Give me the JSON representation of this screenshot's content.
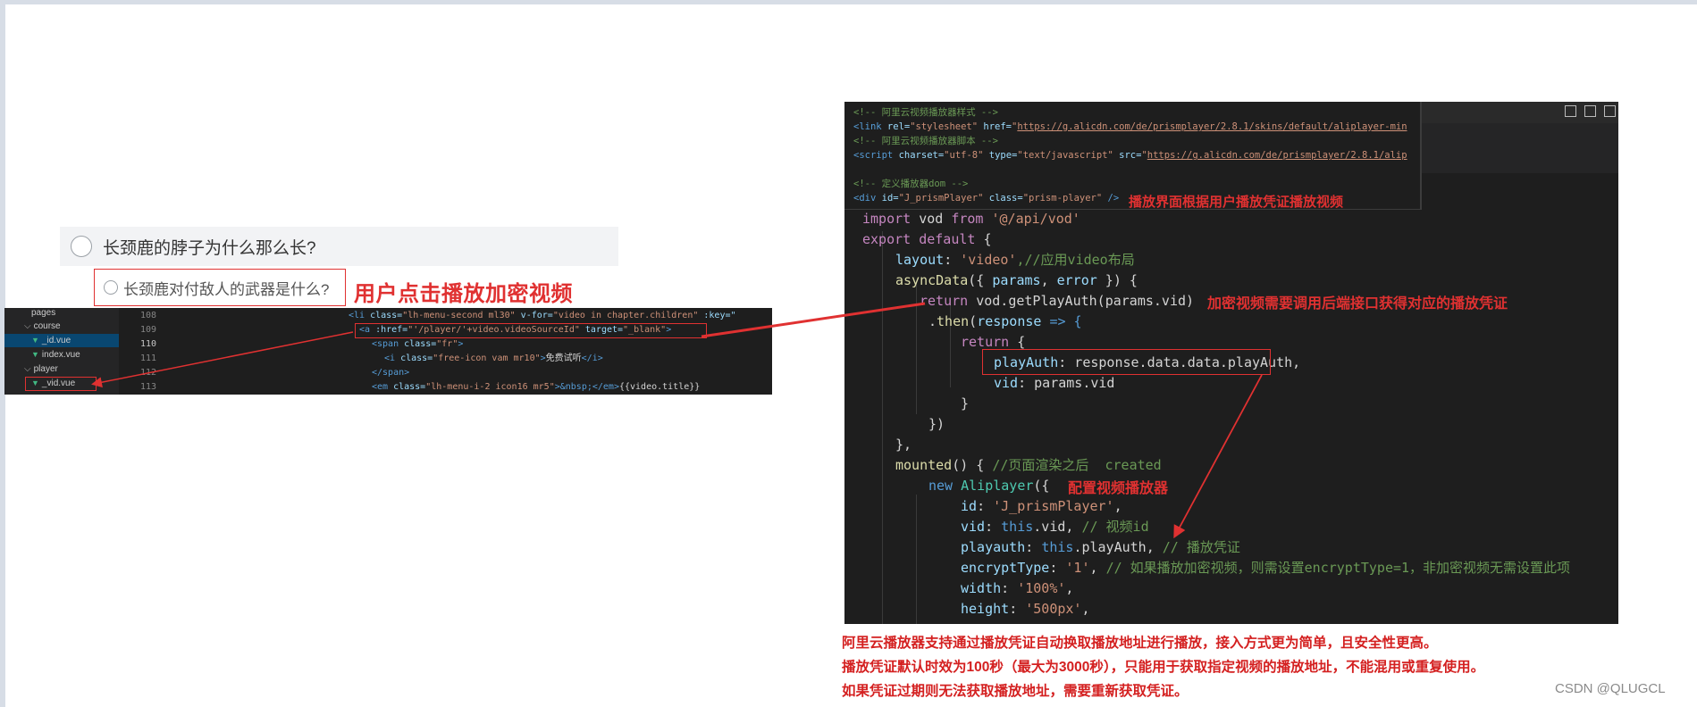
{
  "left": {
    "question_title": "长颈鹿的脖子为什么那么长?",
    "sub_item": "长颈鹿对付敌人的武器是什么?",
    "click_note": "用户点击播放加密视频",
    "tree": [
      "pages",
      "course",
      "_id.vue",
      "index.vue",
      "player",
      "_vid.vue"
    ],
    "line_numbers": [
      "108",
      "109",
      "110",
      "111",
      "112",
      "113"
    ],
    "code": {
      "l108_tag": "<li",
      "l108_attr1": " class=",
      "l108_str1": "\"lh-menu-second ml30\"",
      "l108_attr2": " v-for=",
      "l108_str2": "\"video in chapter.children\"",
      "l108_attr3": " :key=\"",
      "l109_tag": "<a",
      "l109_attr1": " :href=",
      "l109_str1": "\"'/player/'+video.videoSourceId\"",
      "l109_attr2": " target=",
      "l109_str2": "\"_blank\"",
      "l109_close": ">",
      "l110_tag": "<span",
      "l110_attr": " class=",
      "l110_str": "\"fr\"",
      "l110_close": ">",
      "l111_tag": "<i",
      "l111_attr": " class=",
      "l111_str": "\"free-icon vam mr10\"",
      "l111_mid": ">",
      "l111_text": "免费试听",
      "l111_close": "</i>",
      "l112": "</span>",
      "l113_tag": "<em",
      "l113_attr": " class=",
      "l113_str": "\"lh-menu-i-2 icon16 mr5\"",
      "l113_mid": ">&nbsp;</em>",
      "l113_text": "{{video.title}}"
    }
  },
  "right_html": {
    "c1": "<!-- 阿里云视频播放器样式 -->",
    "l2_tag": "<link",
    "l2_attr1": " rel=",
    "l2_str1": "\"stylesheet\"",
    "l2_attr2": " href=",
    "l2_q": "\"",
    "l2_url": "https://g.alicdn.com/de/prismplayer/2.8.1/skins/default/aliplayer-min",
    "c3": "<!-- 阿里云视频播放器脚本 -->",
    "l4_tag": "<script",
    "l4_attr1": " charset=",
    "l4_str1": "\"utf-8\"",
    "l4_attr2": " type=",
    "l4_str2": "\"text/javascript\"",
    "l4_attr3": " src=",
    "l4_q": "\"",
    "l4_url": "https://g.alicdn.com/de/prismplayer/2.8.1/alip",
    "c6": "<!-- 定义播放器dom -->",
    "l7_tag": "<div",
    "l7_attr1": " id=",
    "l7_str1": "\"J_prismPlayer\"",
    "l7_attr2": " class=",
    "l7_str2": "\"prism-player\"",
    "l7_close": " />",
    "note": "播放界面根据用户播放凭证播放视频"
  },
  "right_js": {
    "import_kw": "import",
    "import_mid": " vod ",
    "import_from": "from",
    "import_str": " '@/api/vod'",
    "export_kw": "export default",
    "export_brace": " {",
    "layout_key": "layout",
    "layout_colon": ": ",
    "layout_str": "'video'",
    "layout_com": ",//应用video布局",
    "async_fn": "asyncData",
    "async_open": "({ ",
    "async_p1": "params",
    "async_sep": ", ",
    "async_p2": "error",
    "async_close": " }) {",
    "ret_kw": "return",
    "ret_rest": " vod.getPlayAuth(params.vid)",
    "then_prefix": ".",
    "then_fn": "then",
    "then_open": "(",
    "then_param": "response",
    "then_arrow": " => {",
    "ret2_kw": "return",
    "ret2_brace": " {",
    "pa_key": "playAuth",
    "pa_val": ": response.data.data.playAuth,",
    "vid_key": "vid",
    "vid_val": ": params.vid",
    "close1": "}",
    "close2": "})",
    "close3": "},",
    "mounted_fn": "mounted",
    "mounted_open": "() { ",
    "mounted_com": "//页面渲染之后  created",
    "new_kw": "new",
    "new_cls": " Aliplayer",
    "new_open": "({",
    "id_key": "id",
    "id_colon": ": ",
    "id_str": "'J_prismPlayer'",
    "id_comma": ",",
    "vid2_key": "vid",
    "vid2_colon": ": ",
    "vid2_this": "this",
    "vid2_rest": ".vid, ",
    "vid2_com": "// 视频id",
    "pauth_key": "playauth",
    "pauth_colon": ": ",
    "pauth_this": "this",
    "pauth_rest": ".playAuth, ",
    "pauth_com": "// 播放凭证",
    "enc_key": "encryptType",
    "enc_colon": ": ",
    "enc_str": "'1'",
    "enc_comma": ", ",
    "enc_com": "// 如果播放加密视频，则需设置encryptType=1，非加密视频无需设置此项",
    "w_key": "width",
    "w_colon": ": ",
    "w_str": "'100%'",
    "w_comma": ",",
    "h_key": "height",
    "h_colon": ": ",
    "h_str": "'500px'",
    "h_comma": ",",
    "note_auth": "加密视频需要调用后端接口获得对应的播放凭证",
    "note_player": "配置视频播放器"
  },
  "notes": [
    "阿里云播放器支持通过播放凭证自动换取播放地址进行播放，接入方式更为简单，且安全性更高。",
    "播放凭证默认时效为100秒（最大为3000秒），只能用于获取指定视频的播放地址，不能混用或重复使用。",
    "如果凭证过期则无法获取播放地址，需要重新获取凭证。"
  ],
  "watermark": "CSDN @QLUGCL",
  "colors": {
    "annotation_red": "#e03131",
    "editor_bg": "#1e1e1e"
  }
}
